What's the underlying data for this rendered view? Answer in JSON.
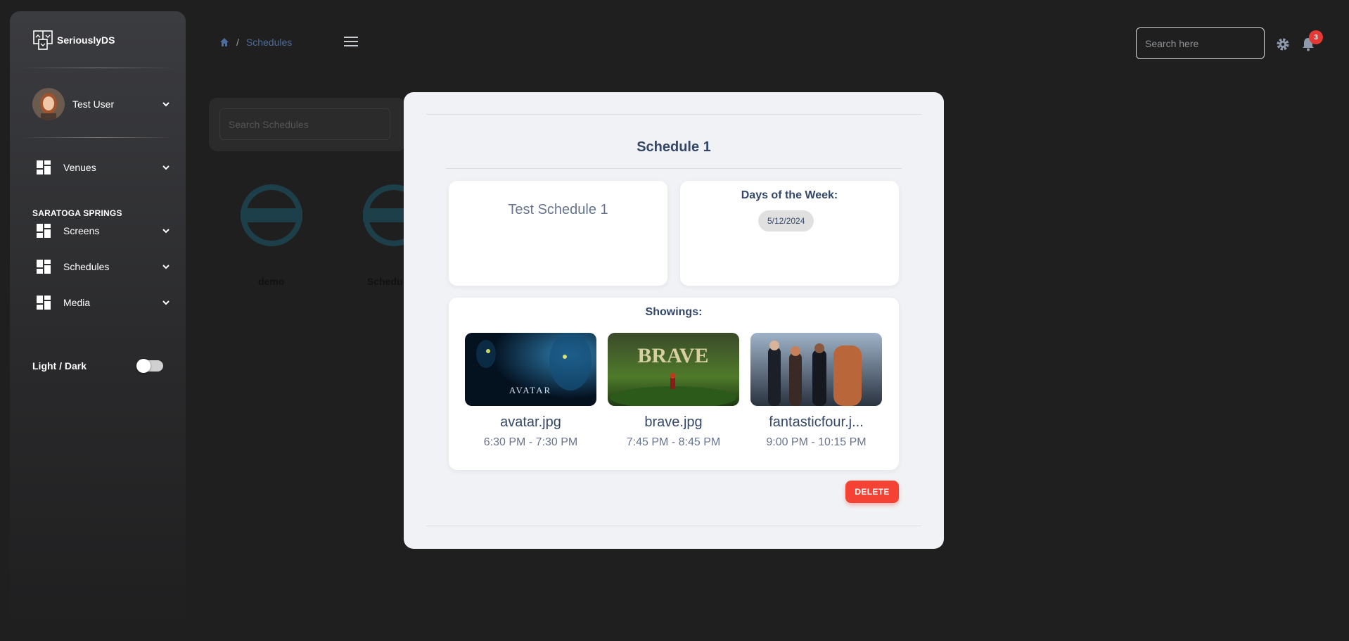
{
  "sidebar": {
    "brand": "SeriouslyDS",
    "user": {
      "name": "Test User"
    },
    "nav": {
      "venues": "Venues",
      "section": "SARATOGA SPRINGS",
      "screens": "Screens",
      "schedules": "Schedules",
      "media": "Media"
    },
    "theme_label": "Light / Dark"
  },
  "topbar": {
    "breadcrumb_sep": "/",
    "breadcrumb_current": "Schedules",
    "search_placeholder": "Search here",
    "notification_count": "3"
  },
  "background": {
    "search_placeholder": "Search Schedules",
    "items": [
      {
        "label": "demo"
      },
      {
        "label": "Schedu"
      }
    ]
  },
  "modal": {
    "title": "Schedule 1",
    "schedule_name": "Test Schedule 1",
    "days_title": "Days of the Week:",
    "days": [
      "5/12/2024"
    ],
    "showings_title": "Showings:",
    "showings": [
      {
        "file": "avatar.jpg",
        "time": "6:30 PM - 7:30 PM",
        "poster_text": "AVATAR"
      },
      {
        "file": "brave.jpg",
        "time": "7:45 PM - 8:45 PM",
        "poster_text": "BRAVE"
      },
      {
        "file": "fantasticfour.j...",
        "time": "9:00 PM - 10:15 PM",
        "poster_text": ""
      }
    ],
    "delete_label": "DELETE"
  },
  "colors": {
    "accent_blue": "#4d6c9b",
    "danger": "#f44335",
    "badge": "#e53935",
    "title_text": "#344767"
  }
}
